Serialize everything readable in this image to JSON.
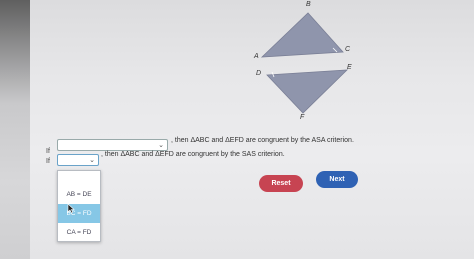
{
  "figure": {
    "vertices": {
      "A": "A",
      "B": "B",
      "C": "C",
      "D": "D",
      "E": "E",
      "F": "F"
    }
  },
  "statements": [
    {
      "if_label": "If",
      "select_value": "",
      "text": ", then ΔABC and ΔEFD are congruent by the ASA criterion."
    },
    {
      "if_label": "If",
      "select_value": "",
      "text": ", then ΔABC and ΔEFD are congruent by the SAS criterion."
    }
  ],
  "dropdown_options": [
    "AB = DE",
    "BC = FD",
    "CA = FD"
  ],
  "selected_option_index": 1,
  "buttons": {
    "reset": "Reset",
    "next": "Next"
  },
  "colors": {
    "triangle_fill": "#8f95ac",
    "reset": "#c74452",
    "next": "#2f62b4",
    "selected_option": "#86c7e6"
  }
}
